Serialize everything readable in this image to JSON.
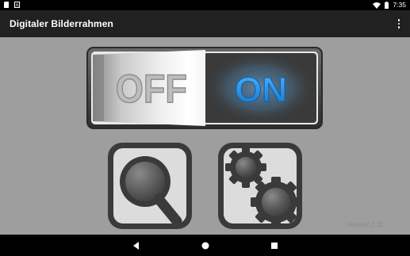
{
  "status_bar": {
    "time": "7:35",
    "icons": [
      "sd-card-icon",
      "notification-a-icon",
      "wifi-icon",
      "battery-icon"
    ]
  },
  "app_bar": {
    "title": "Digitaler Bilderrahmen",
    "menu_icon": "overflow-menu-icon"
  },
  "toggle": {
    "off_label": "OFF",
    "on_label": "ON",
    "state": "on"
  },
  "tiles": {
    "search_icon": "magnifier-icon",
    "settings_icon": "gears-icon"
  },
  "version_text": "Version: 2.31",
  "nav_bar": {
    "icons": [
      "back-icon",
      "home-icon",
      "recents-icon"
    ]
  },
  "colors": {
    "background": "#9e9e9e",
    "app_bar": "#212121",
    "on_label": "#1b8fe0",
    "tile_frame": "#3a3a3a"
  }
}
